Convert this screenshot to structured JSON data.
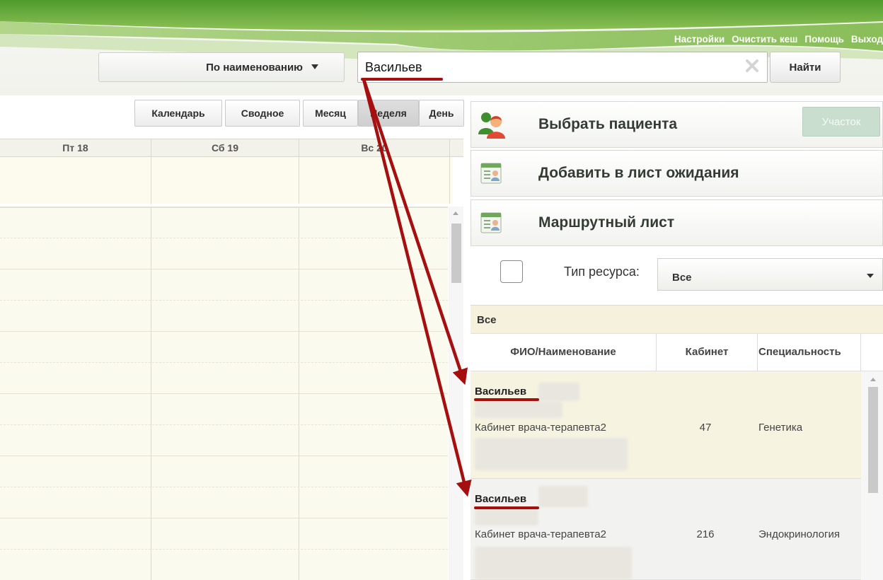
{
  "header": {
    "links": [
      "Настройки",
      "Очистить кеш",
      "Помощь",
      "Выход"
    ]
  },
  "search": {
    "mode_label": "По наименованию",
    "value": "Васильев",
    "find_label": "Найти"
  },
  "calendar": {
    "view_buttons": [
      "Календарь",
      "Сводное"
    ],
    "period_buttons": [
      "Месяц",
      "Неделя",
      "День"
    ],
    "active_period": "Неделя",
    "day_headers": [
      "Пт 18",
      "Сб 19",
      "Вс 20"
    ]
  },
  "actions": {
    "select_patient": "Выбрать пациента",
    "uchastok": "Участок",
    "waitlist": "Добавить в лист ожидания",
    "route_sheet": "Маршрутный лист"
  },
  "filter": {
    "resource_type_label": "Тип ресурса:",
    "resource_type_value": "Все"
  },
  "resources": {
    "group": "Все",
    "columns": [
      "ФИО/Наименование",
      "Кабинет",
      "Специальность"
    ],
    "rows": [
      {
        "name": "Васильев",
        "room_name": "Кабинет врача-терапевта2",
        "room": "47",
        "specialty": "Генетика"
      },
      {
        "name": "Васильев",
        "room_name": "Кабинет врача-терапевта2",
        "room": "216",
        "specialty": "Эндокринология"
      }
    ]
  },
  "colors": {
    "header_green": "#7fb23a",
    "annotation_red": "#a50f0f",
    "row_highlight": "#f7f3e1"
  }
}
